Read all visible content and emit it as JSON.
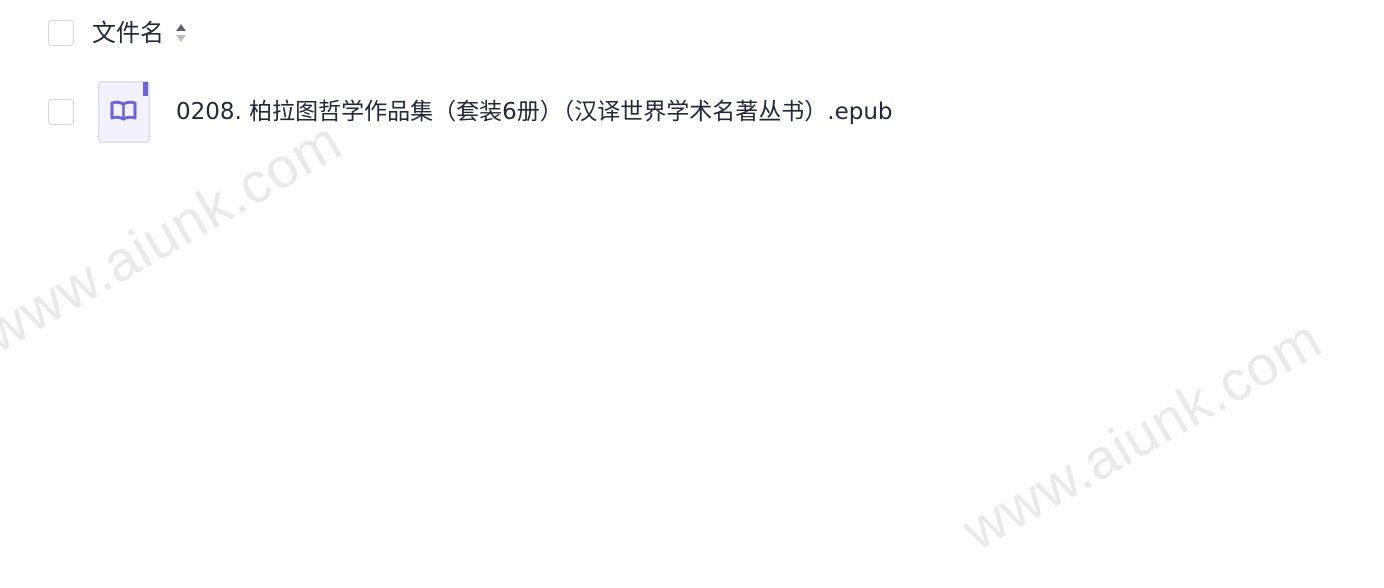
{
  "file_list": {
    "header": {
      "column_label": "文件名",
      "sort_icon": "sort-updown-icon"
    },
    "rows": [
      {
        "name": "0208. 柏拉图哲学作品集（套装6册）（汉译世界学术名著丛书）.epub",
        "icon": "ebook-file-icon"
      }
    ]
  },
  "watermark": {
    "text": "www.aiunk.com"
  },
  "colors": {
    "text": "#23283a",
    "checkbox_border": "#d6d8de",
    "icon_accent": "#6b63d6",
    "icon_bg": "#f3f2fc",
    "watermark": "#e9e9e9"
  }
}
